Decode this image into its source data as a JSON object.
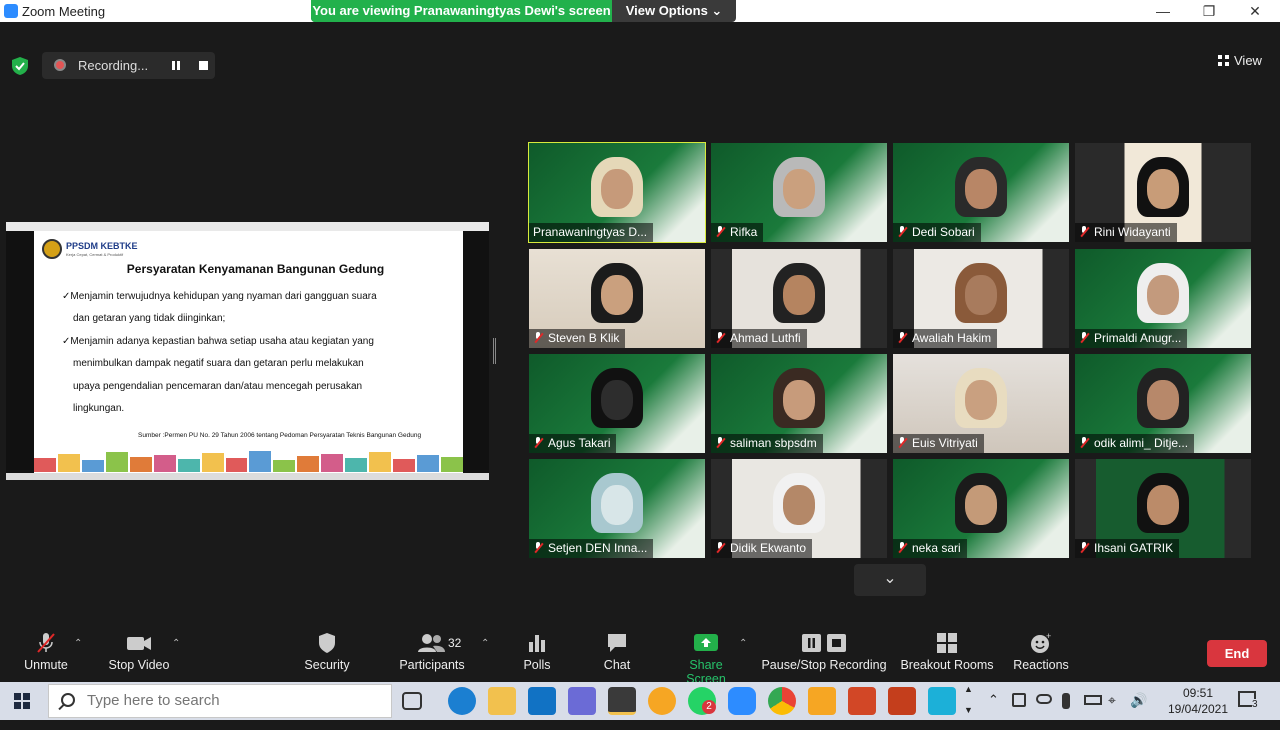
{
  "window": {
    "title": "Zoom Meeting"
  },
  "banner": {
    "viewing": "You are viewing Pranawaningtyas Dewi's screen",
    "view_options": "View Options ⌄"
  },
  "recording": {
    "label": "Recording..."
  },
  "view_button": {
    "label": "View"
  },
  "slide": {
    "brand": "PPSDM KEBTKE",
    "tagline": "Kerja Cepat, Cermat & Produktif",
    "title": "Persyaratan Kenyamanan  Bangunan Gedung",
    "bullets": [
      {
        "line1": "✓Menjamin terwujudnya kehidupan yang nyaman dari gangguan suara",
        "line2": "dan getaran yang tidak diinginkan;"
      },
      {
        "line1": "✓Menjamin adanya kepastian bahwa setiap usaha atau kegiatan yang",
        "line2": "menimbulkan dampak negatif suara dan getaran perlu melakukan",
        "line3": "upaya pengendalian pencemaran dan/atau mencegah perusakan",
        "line4": "lingkungan."
      }
    ],
    "source": "Sumber :Permen PU No. 29 Tahun 2006 tentang Pedoman Persyaratan Teknis Bangunan Gedung"
  },
  "participants_tiles": [
    {
      "name": "Pranawaningtyas D...",
      "muted": false
    },
    {
      "name": "Rifka",
      "muted": true
    },
    {
      "name": "Dedi Sobari",
      "muted": true
    },
    {
      "name": "Rini Widayanti",
      "muted": true
    },
    {
      "name": "Steven B Klik",
      "muted": true
    },
    {
      "name": "Ahmad Luthfi",
      "muted": true
    },
    {
      "name": "Awaliah Hakim",
      "muted": true
    },
    {
      "name": "Primaldi Anugr...",
      "muted": true
    },
    {
      "name": "Agus Takari",
      "muted": true
    },
    {
      "name": "saliman sbpsdm",
      "muted": true
    },
    {
      "name": "Euis Vitriyati",
      "muted": true
    },
    {
      "name": "odik alimi_ Ditje...",
      "muted": true
    },
    {
      "name": "Setjen DEN Inna...",
      "muted": true
    },
    {
      "name": "Didik Ekwanto",
      "muted": true
    },
    {
      "name": "neka sari",
      "muted": true
    },
    {
      "name": "Ihsani GATRIK",
      "muted": true
    }
  ],
  "toolbar": {
    "unmute": "Unmute",
    "stop_video": "Stop Video",
    "security": "Security",
    "participants": "Participants",
    "participants_count": "32",
    "polls": "Polls",
    "chat": "Chat",
    "share_screen": "Share Screen",
    "pause_recording": "Pause/Stop Recording",
    "breakout": "Breakout Rooms",
    "reactions": "Reactions",
    "end": "End"
  },
  "taskbar": {
    "search_placeholder": "Type here to search",
    "whatsapp_badge": "2",
    "time": "09:51",
    "date": "19/04/2021",
    "notifications": "3"
  },
  "colors": {
    "zoom_blue": "#2d8cff",
    "share_green": "#22b14c",
    "end_red": "#d9363e",
    "active_speaker": "#d8ea3c"
  }
}
